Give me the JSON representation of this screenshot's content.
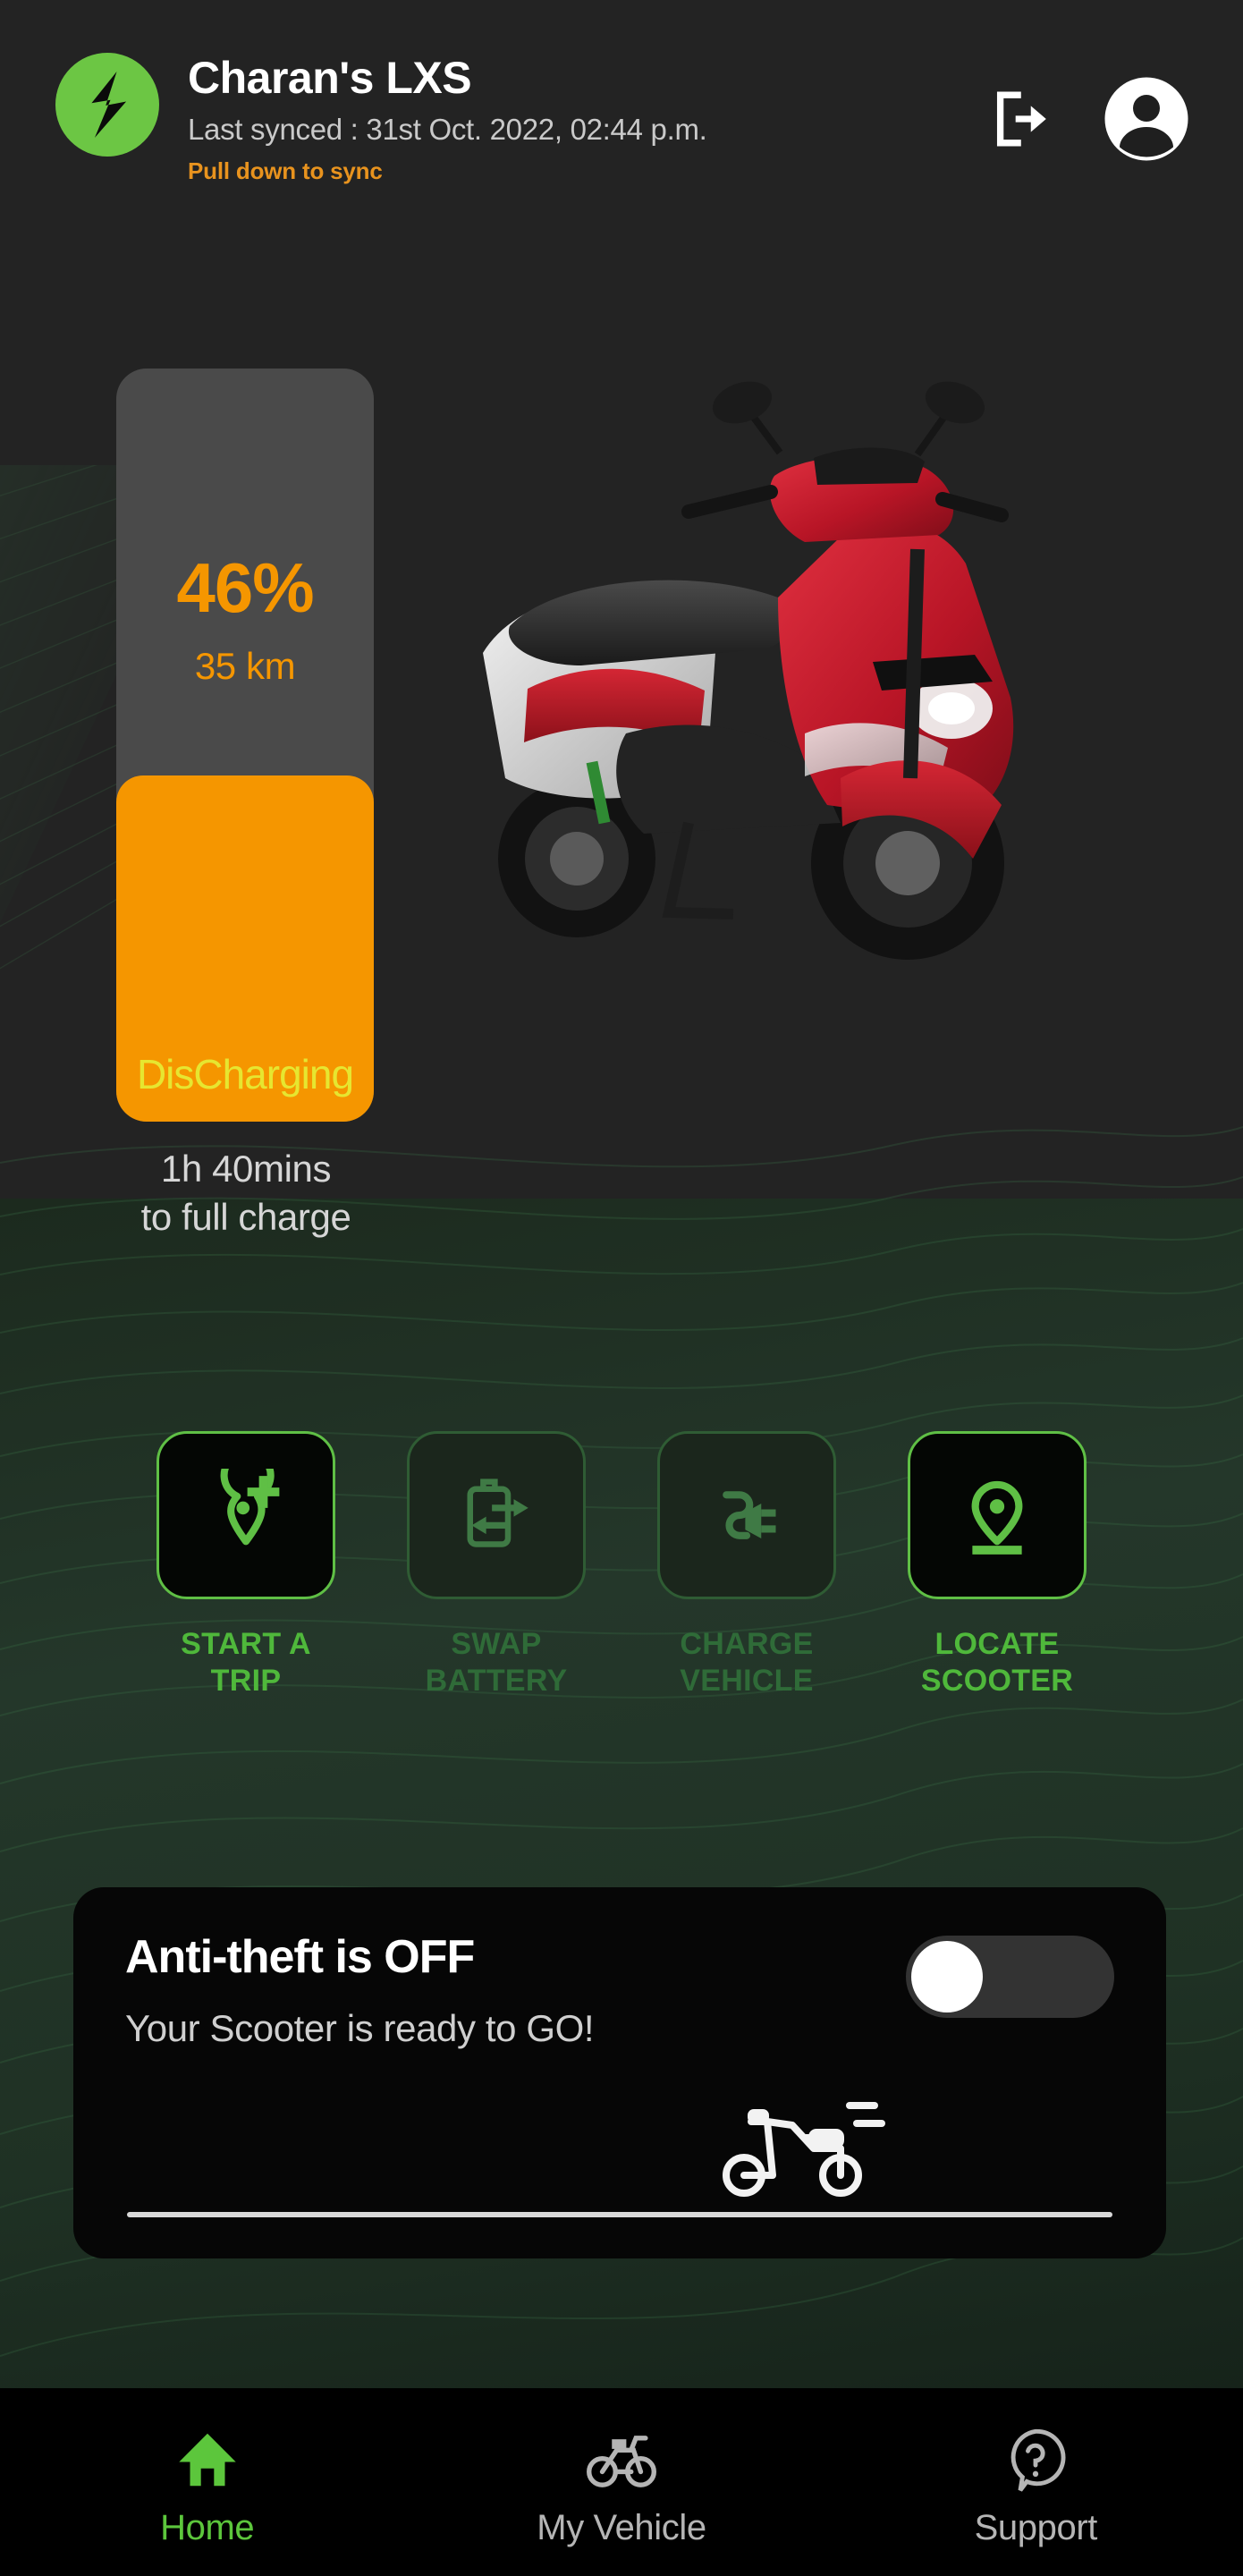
{
  "header": {
    "logo_icon": "lightning-bolt-logo",
    "title": "Charan's LXS",
    "last_synced": "Last synced : 31st Oct. 2022, 02:44 p.m.",
    "pull_hint": "Pull down to sync",
    "logout_icon": "logout-icon",
    "avatar_icon": "account-avatar-icon"
  },
  "battery": {
    "percent_label": "46%",
    "percent_value": 46,
    "range_label": "35 km",
    "status_label": "DisCharging",
    "charge_time_line1": "1h 40mins",
    "charge_time_line2": "to full charge",
    "fill_color": "#F59600",
    "track_color": "#4a4a4a",
    "status_text_color": "#E6E630"
  },
  "vehicle": {
    "image_alt": "red-and-silver-electric-scooter"
  },
  "actions": [
    {
      "icon": "map-pin-plus-icon",
      "line1": "START A",
      "line2": "TRIP",
      "enabled": true
    },
    {
      "icon": "battery-swap-icon",
      "line1": "SWAP",
      "line2": "BATTERY",
      "enabled": false
    },
    {
      "icon": "power-plug-icon",
      "line1": "CHARGE",
      "line2": "VEHICLE",
      "enabled": false
    },
    {
      "icon": "locate-pin-icon",
      "line1": "LOCATE",
      "line2": "SCOOTER",
      "enabled": true
    }
  ],
  "anti_theft": {
    "title": "Anti-theft is OFF",
    "subtitle": "Your Scooter is ready to GO!",
    "toggle_state": "off",
    "scooter_icon": "scooter-side-icon"
  },
  "bottom_nav": [
    {
      "icon": "home-icon",
      "label": "Home",
      "active": true
    },
    {
      "icon": "bicycle-icon",
      "label": "My Vehicle",
      "active": false
    },
    {
      "icon": "help-question-icon",
      "label": "Support",
      "active": false
    }
  ],
  "colors": {
    "accent_green": "#5CC63C",
    "accent_orange": "#F59600",
    "warning_orange": "#E8931E",
    "dim_green": "#2f6b38"
  }
}
